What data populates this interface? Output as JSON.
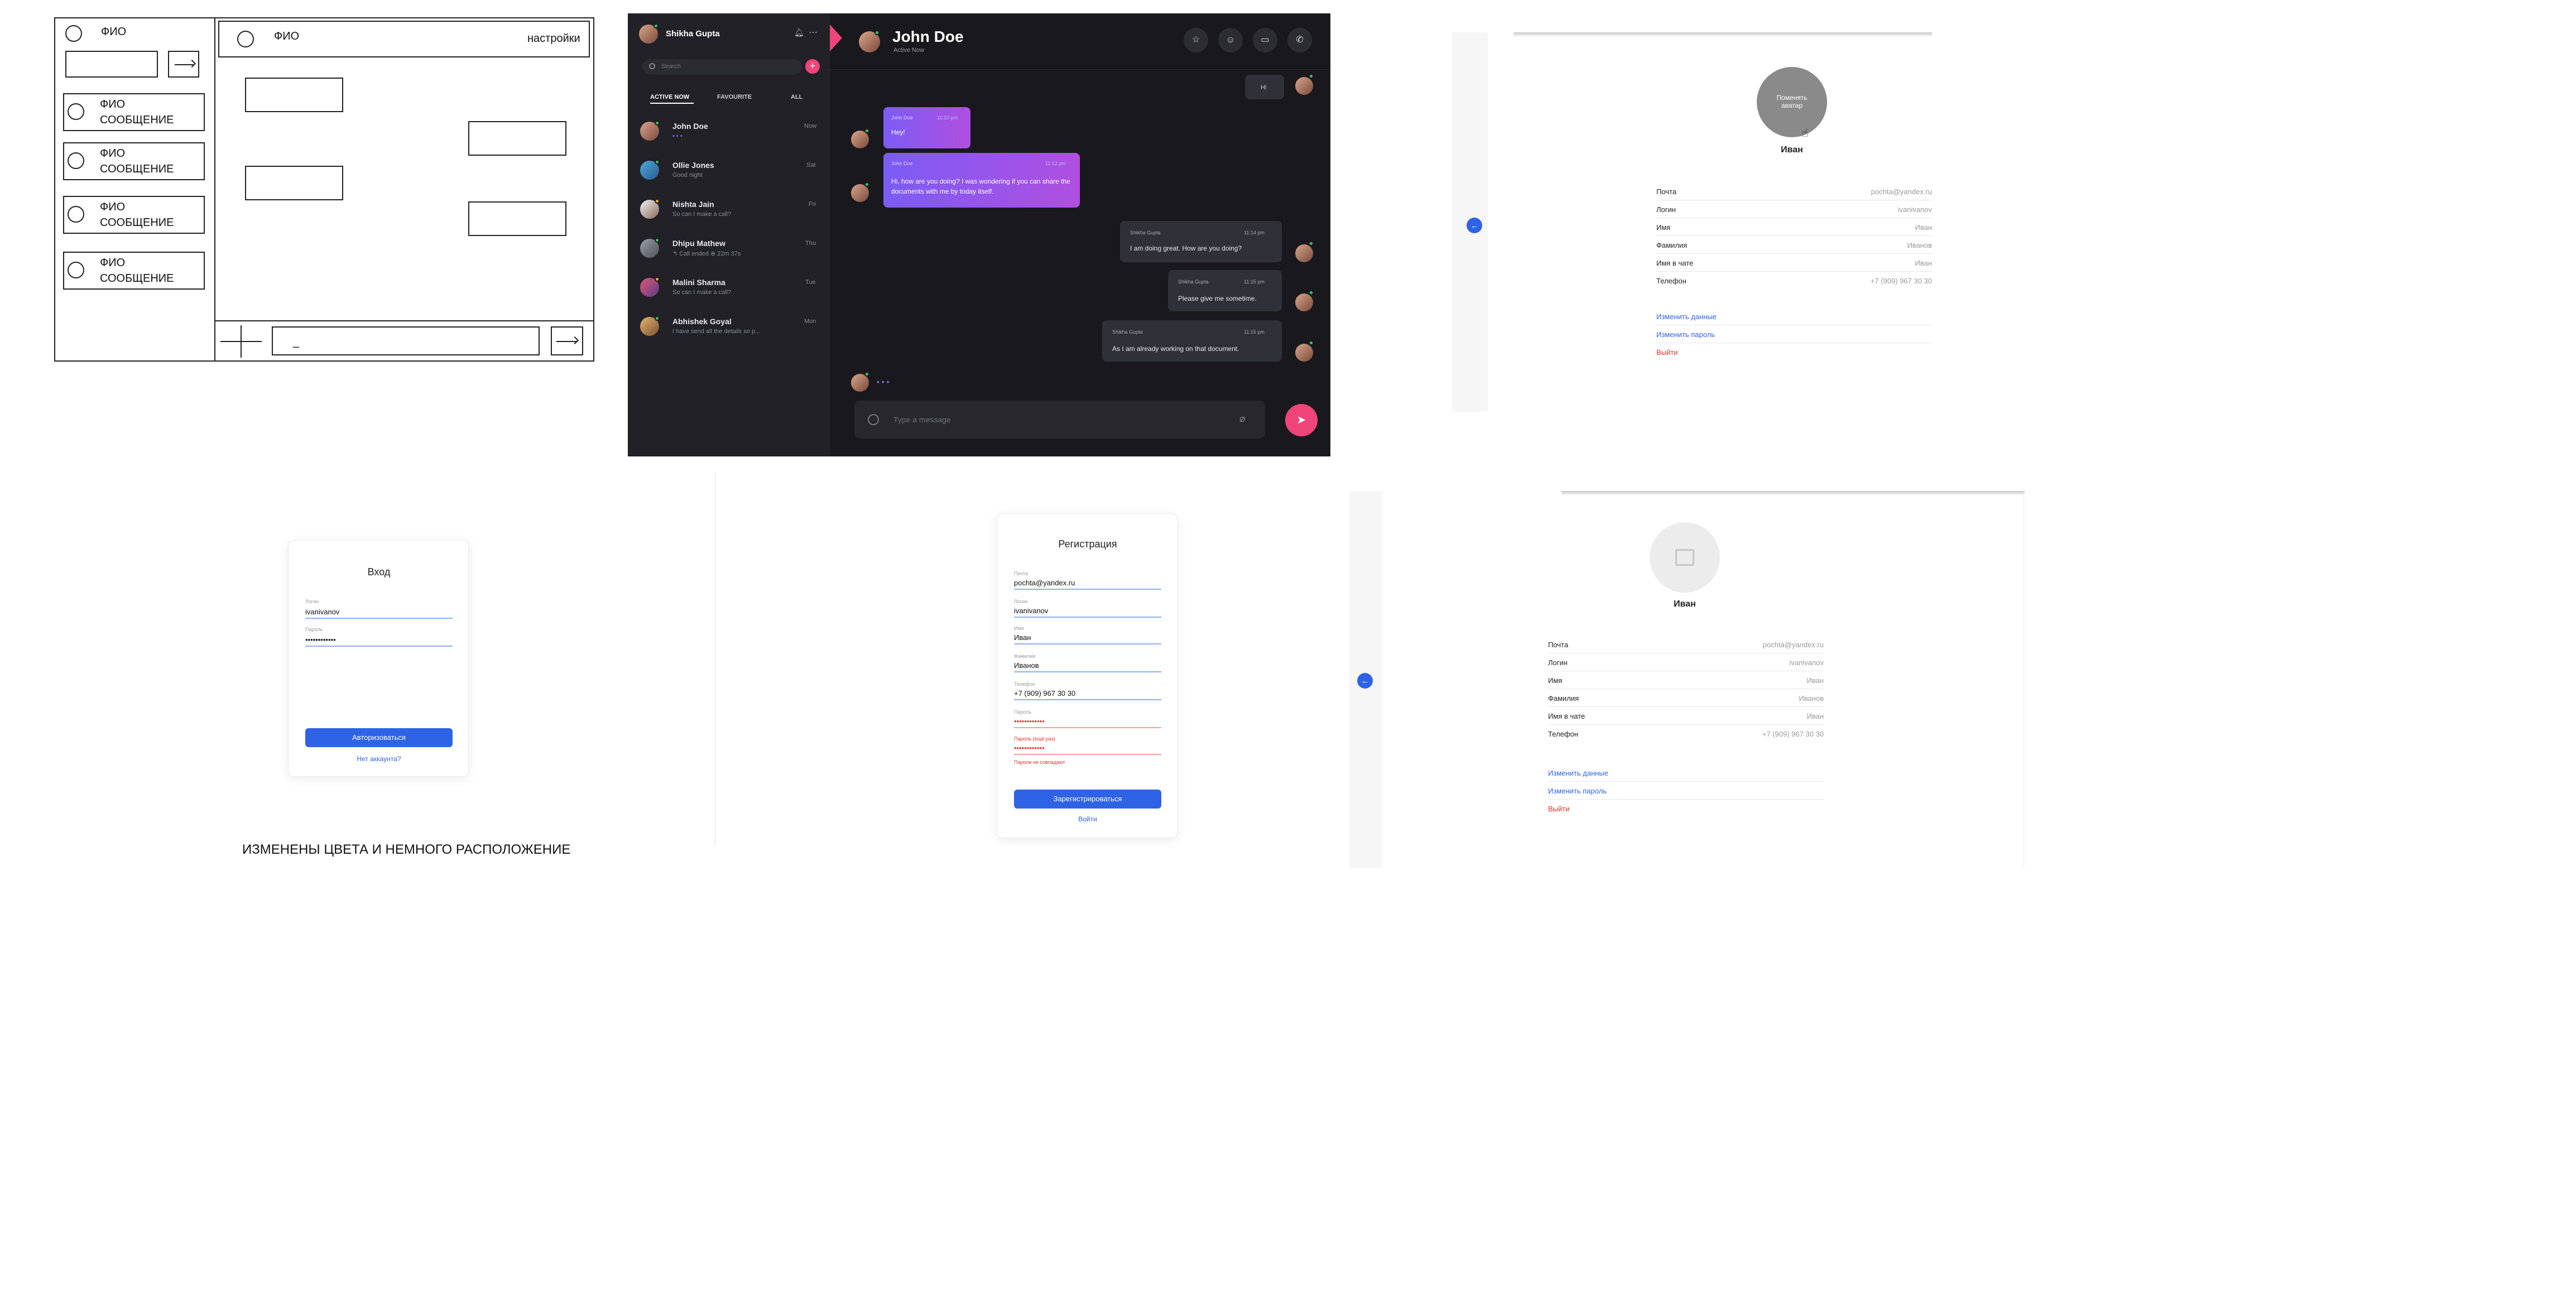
{
  "wireframe": {
    "fio": "ФИО",
    "message": "СООБЩЕНИЕ",
    "settings": "настройки",
    "input_cursor": "_",
    "caption": "ИЗМЕНЕНЫ ЦВЕТА И НЕМНОГО РАСПОЛОЖЕНИЕ"
  },
  "chat": {
    "user_name": "Shikha Gupta",
    "search_placeholder": "Search",
    "tabs": [
      "ACTIVE NOW",
      "FAVOURITE",
      "ALL"
    ],
    "contacts": [
      {
        "name": "John Doe",
        "message": "• • •",
        "day": "Now",
        "status": "online"
      },
      {
        "name": "Ollie Jones",
        "message": "Good night",
        "day": "Sat",
        "status": "online"
      },
      {
        "name": "Nishta Jain",
        "message": "So can I make a call?",
        "day": "Fri",
        "status": "away"
      },
      {
        "name": "Dhipu Mathew",
        "message": "↰ Call ended  ⊕ 22m 37s",
        "day": "Thu",
        "status": "online"
      },
      {
        "name": "Malini Sharma",
        "message": "So can I make a call?",
        "day": "Tue",
        "status": "away"
      },
      {
        "name": "Abhishek Goyal",
        "message": "I have send all the details so p...",
        "day": "Mon",
        "status": "online"
      }
    ],
    "header": {
      "name": "John Doe",
      "status": "Active Now"
    },
    "messages": [
      {
        "sender": "",
        "time": "",
        "text": "Hi",
        "out": true
      },
      {
        "sender": "John Doe",
        "time": "11:10 pm",
        "text": "Hey!",
        "out": false
      },
      {
        "sender": "John Doe",
        "time": "11:12 pm",
        "text": "Hi, how are you doing? I was wondering if you can share the documents with me by today itself.",
        "out": false
      },
      {
        "sender": "Shikha Gupta",
        "time": "11:14 pm",
        "text": "I am doing great. How are you doing?",
        "out": true
      },
      {
        "sender": "Shikha Gupta",
        "time": "11:15 pm",
        "text": "Please give me sometime.",
        "out": true
      },
      {
        "sender": "Shikha Gupta",
        "time": "11:15 pm",
        "text": "As I am already working on that document.",
        "out": true
      }
    ],
    "typing": "• • •",
    "input_placeholder": "Type a message",
    "colors": {
      "accent": "#f0457a",
      "bubble_in_start": "#7b5cf5",
      "bubble_in_end": "#b04fe0",
      "online": "#35c759",
      "away": "#f5a623"
    }
  },
  "profile_top": {
    "avatar_overlay": "Поменять аватар",
    "name": "Иван",
    "fields": [
      {
        "label": "Почта",
        "value": "pochta@yandex.ru"
      },
      {
        "label": "Логин",
        "value": "ivanivanov"
      },
      {
        "label": "Имя",
        "value": "Иван"
      },
      {
        "label": "Фамилия",
        "value": "Иванов"
      },
      {
        "label": "Имя в чате",
        "value": "Иван"
      },
      {
        "label": "Телефон",
        "value": "+7 (909) 967 30 30"
      }
    ],
    "edit_data": "Изменить данные",
    "edit_password": "Изменить пароль",
    "logout": "Выйти"
  },
  "login": {
    "title": "Вход",
    "login_label": "Логин",
    "login_value": "ivanivanov",
    "password_label": "Пароль",
    "password_value": "••••••••••••",
    "submit": "Авторизоваться",
    "no_account": "Нет аккаунта?"
  },
  "register": {
    "title": "Регистрация",
    "fields": [
      {
        "label": "Почта",
        "value": "pochta@yandex.ru",
        "error": false
      },
      {
        "label": "Логин",
        "value": "ivanivanov",
        "error": false
      },
      {
        "label": "Имя",
        "value": "Иван",
        "error": false
      },
      {
        "label": "Фамилия",
        "value": "Иванов",
        "error": false
      },
      {
        "label": "Телефон",
        "value": "+7 (909) 967 30 30",
        "error": false
      },
      {
        "label": "Пароль",
        "value": "••••••••••••",
        "error": true
      },
      {
        "label": "Пароль (ещё раз)",
        "value": "••••••••••••",
        "error": true
      }
    ],
    "error_text": "Пароли не совпадают",
    "submit": "Зарегистрироваться",
    "logout": "Войти"
  },
  "profile_bottom": {
    "name": "Иван",
    "fields": [
      {
        "label": "Почта",
        "value": "pochta@yandex.ru"
      },
      {
        "label": "Логин",
        "value": "ivanivanov"
      },
      {
        "label": "Имя",
        "value": "Иван"
      },
      {
        "label": "Фамилия",
        "value": "Иванов"
      },
      {
        "label": "Имя в чате",
        "value": "Иван"
      },
      {
        "label": "Телефон",
        "value": "+7 (909) 967 30 30"
      }
    ],
    "edit_data": "Изменить данные",
    "edit_password": "Изменить пароль",
    "logout": "Выйти"
  }
}
